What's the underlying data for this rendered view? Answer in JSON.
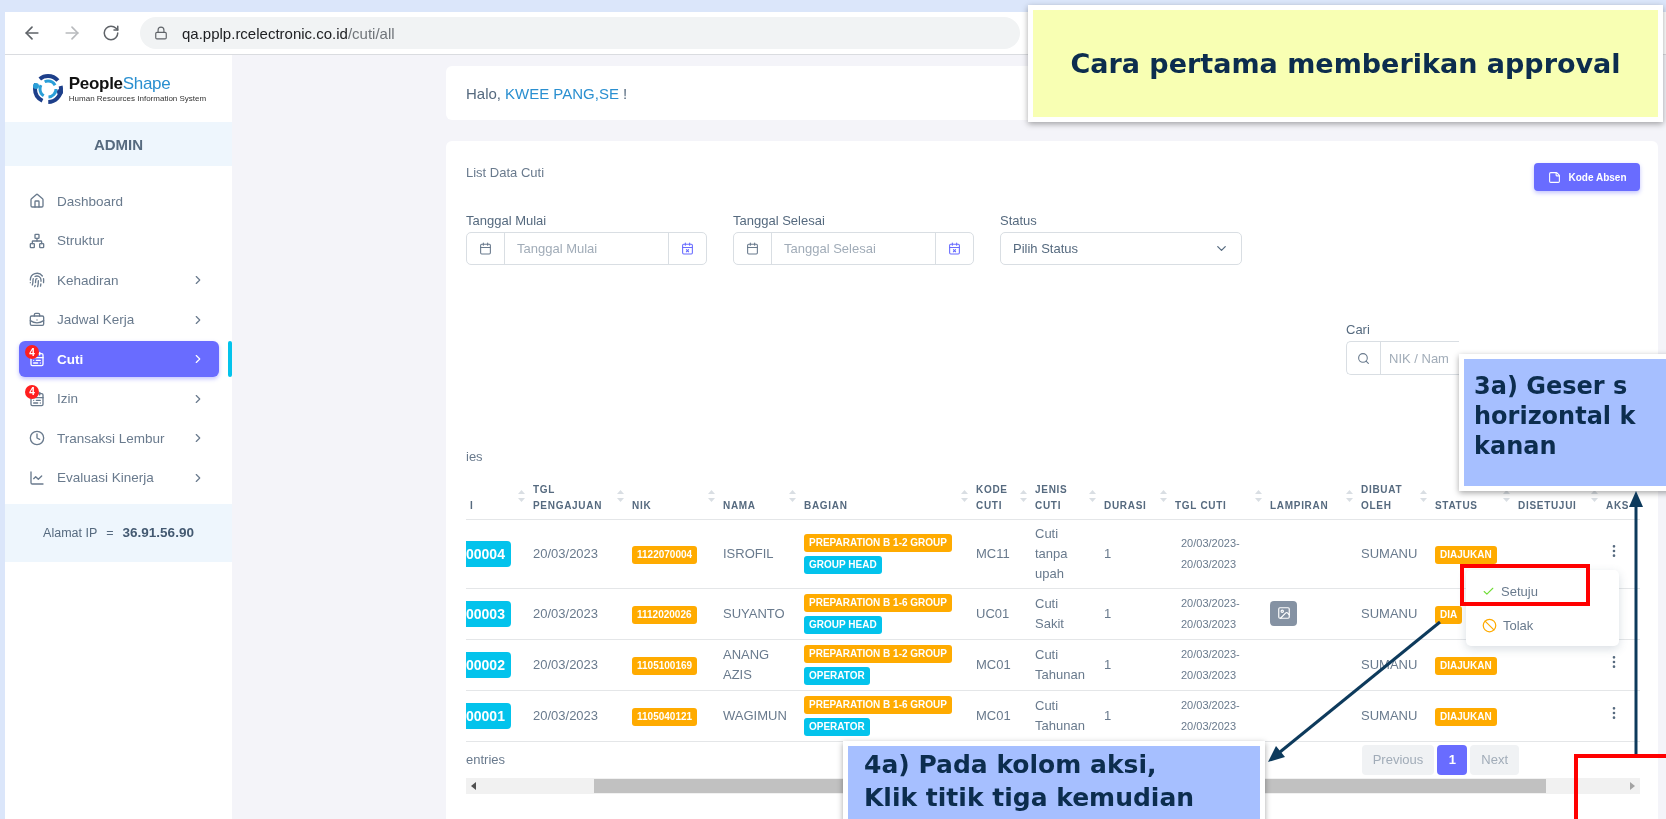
{
  "browser": {
    "url_host": "qa.pplp.rcelectronic.co.id",
    "url_path": "/cuti/all",
    "forward_disabled": true
  },
  "sidebar": {
    "logo": {
      "name": "People",
      "name_accent": "Shape",
      "tagline": "Human Resources Information System"
    },
    "role": "ADMIN",
    "items": [
      {
        "label": "Dashboard",
        "selected": false,
        "has_submenu": false
      },
      {
        "label": "Struktur",
        "selected": false,
        "has_submenu": false
      },
      {
        "label": "Kehadiran",
        "selected": false,
        "has_submenu": true
      },
      {
        "label": "Jadwal Kerja",
        "selected": false,
        "has_submenu": true
      },
      {
        "label": "Cuti",
        "selected": true,
        "has_submenu": true,
        "badge": "4"
      },
      {
        "label": "Izin",
        "selected": false,
        "has_submenu": true,
        "badge": "4"
      },
      {
        "label": "Transaksi Lembur",
        "selected": false,
        "has_submenu": true
      },
      {
        "label": "Evaluasi Kinerja",
        "selected": false,
        "has_submenu": true
      }
    ],
    "ip": {
      "label": "Alamat IP",
      "separator": "=",
      "value": "36.91.56.90"
    }
  },
  "greeting": {
    "prefix": "Halo,",
    "name": "KWEE PANG,SE",
    "suffix": "!"
  },
  "card": {
    "title": "List Data Cuti",
    "button": "Kode Absen",
    "filters": [
      {
        "kind": "date",
        "label": "Tanggal Mulai",
        "placeholder": "Tanggal Mulai"
      },
      {
        "kind": "date",
        "label": "Tanggal Selesai",
        "placeholder": "Tanggal Selesai"
      },
      {
        "kind": "select",
        "label": "Status",
        "value": "Pilih Status"
      }
    ],
    "search": {
      "label": "Cari",
      "placeholder": "NIK / Nam"
    },
    "length_text": "ies",
    "info_text": "entries"
  },
  "table": {
    "columns": [
      {
        "label": "I",
        "sortable": true
      },
      {
        "label": "TGL PENGAJUAN",
        "sortable": true
      },
      {
        "label": "NIK",
        "sortable": true
      },
      {
        "label": "NAMA",
        "sortable": true
      },
      {
        "label": "BAGIAN",
        "sortable": true
      },
      {
        "label": "KODE CUTI",
        "sortable": true
      },
      {
        "label": "JENIS CUTI",
        "sortable": true
      },
      {
        "label": "DURASI",
        "sortable": true
      },
      {
        "label": "TGL CUTI",
        "sortable": true
      },
      {
        "label": "LAMPIRAN",
        "sortable": true
      },
      {
        "label": "DIBUAT OLEH",
        "sortable": true
      },
      {
        "label": "STATUS",
        "sortable": true
      },
      {
        "label": "DISETUJUI",
        "sortable": true
      },
      {
        "label": "AKS",
        "sortable": false
      }
    ],
    "rows": [
      {
        "id": "00004",
        "tgl_pengajuan": "20/03/2023",
        "nik": "1122070004",
        "nama": "ISROFIL",
        "bagian": "PREPARATION B 1-2 GROUP",
        "jabatan": "GROUP HEAD",
        "kode_cuti": "MC11",
        "jenis_cuti": "Cuti tanpa upah",
        "durasi": "1",
        "tgl_cuti": "20/03/2023-20/03/2023",
        "lampiran": false,
        "dibuat_oleh": "SUMANU",
        "status": "DIAJUKAN"
      },
      {
        "id": "00003",
        "tgl_pengajuan": "20/03/2023",
        "nik": "1112020026",
        "nama": "SUYANTO",
        "bagian": "PREPARATION B 1-6 GROUP",
        "jabatan": "GROUP HEAD",
        "kode_cuti": "UC01",
        "jenis_cuti": "Cuti Sakit",
        "durasi": "1",
        "tgl_cuti": "20/03/2023-20/03/2023",
        "lampiran": true,
        "dibuat_oleh": "SUMANU",
        "status": "DIA"
      },
      {
        "id": "00002",
        "tgl_pengajuan": "20/03/2023",
        "nik": "1105100169",
        "nama": "ANANG AZIS",
        "bagian": "PREPARATION B 1-2 GROUP",
        "jabatan": "OPERATOR",
        "kode_cuti": "MC01",
        "jenis_cuti": "Cuti Tahunan",
        "durasi": "1",
        "tgl_cuti": "20/03/2023-20/03/2023",
        "lampiran": false,
        "dibuat_oleh": "SUMANU",
        "status": "DIAJUKAN"
      },
      {
        "id": "00001",
        "tgl_pengajuan": "20/03/2023",
        "nik": "1105040121",
        "nama": "WAGIMUN",
        "bagian": "PREPARATION B 1-6 GROUP",
        "jabatan": "OPERATOR",
        "kode_cuti": "MC01",
        "jenis_cuti": "Cuti Tahunan",
        "durasi": "1",
        "tgl_cuti": "20/03/2023-20/03/2023",
        "lampiran": false,
        "dibuat_oleh": "SUMANU",
        "status": "DIAJUKAN"
      }
    ]
  },
  "pagination": {
    "previous": "Previous",
    "pages": [
      {
        "label": "1",
        "selected": true
      }
    ],
    "next": "Next"
  },
  "action_menu": {
    "items": [
      {
        "kind": "approve",
        "label": "Setuju"
      },
      {
        "kind": "reject",
        "label": "Tolak"
      }
    ]
  },
  "annotations": {
    "title": "Cara pertama memberikan approval",
    "step_scroll": "3a) Geser s\nhorizontal k\nkanan",
    "step_action": "4a) Pada kolom aksi,\nKlik titik tiga kemudian"
  }
}
